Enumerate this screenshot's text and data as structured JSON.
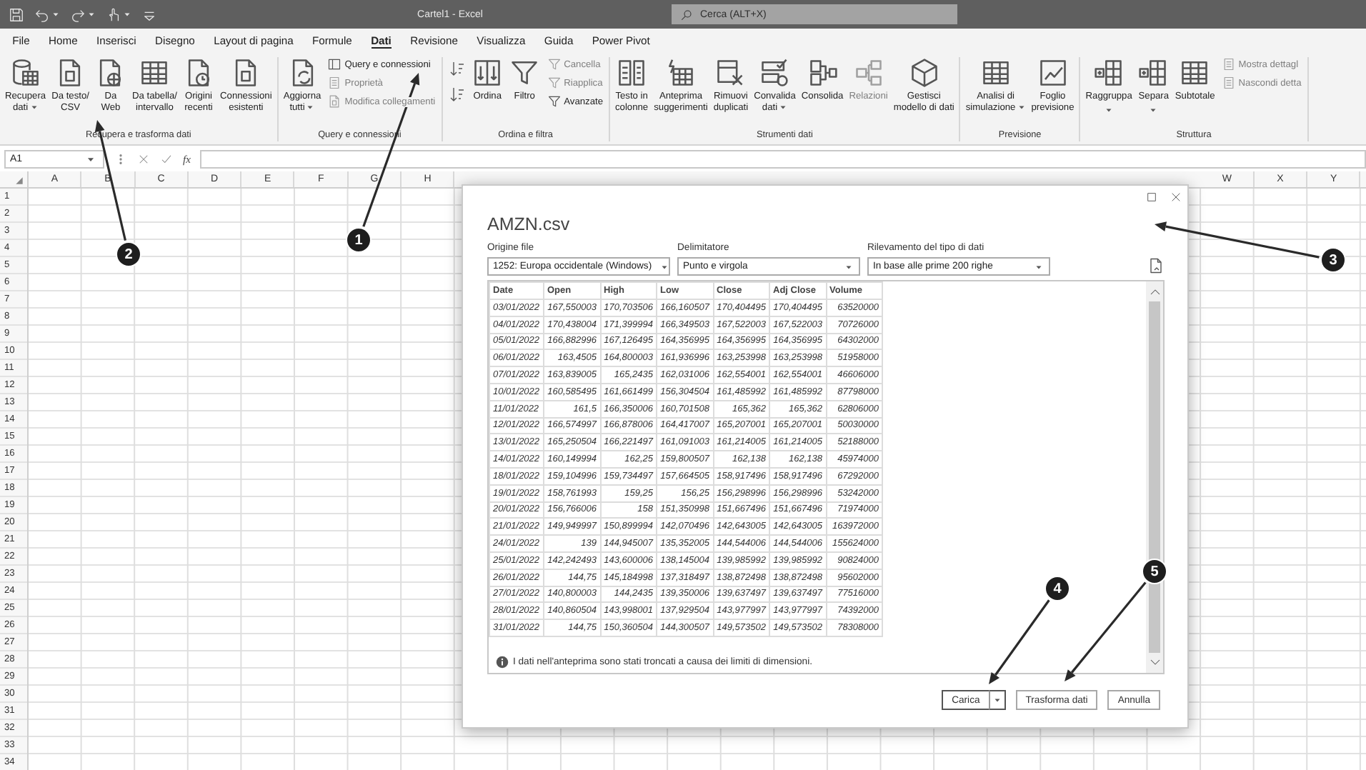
{
  "window": {
    "title": "Cartel1 - Excel"
  },
  "search": {
    "placeholder": "Cerca (ALT+X)"
  },
  "menu_tabs": [
    {
      "label": "File",
      "selected": false
    },
    {
      "label": "Home",
      "selected": false
    },
    {
      "label": "Inserisci",
      "selected": false
    },
    {
      "label": "Disegno",
      "selected": false
    },
    {
      "label": "Layout di pagina",
      "selected": false
    },
    {
      "label": "Formule",
      "selected": false
    },
    {
      "label": "Dati",
      "selected": true
    },
    {
      "label": "Revisione",
      "selected": false
    },
    {
      "label": "Visualizza",
      "selected": false
    },
    {
      "label": "Guida",
      "selected": false
    },
    {
      "label": "Power Pivot",
      "selected": false
    }
  ],
  "ribbon": {
    "groups": [
      {
        "label": "Recupera e trasforma dati",
        "buttons": [
          {
            "kind": "large",
            "label": "Recupera\ndati",
            "dropdown": true,
            "disabled": false
          },
          {
            "kind": "large",
            "label": "Da testo/\nCSV",
            "dropdown": false,
            "disabled": false
          },
          {
            "kind": "large",
            "label": "Da\nWeb",
            "dropdown": false,
            "disabled": false
          },
          {
            "kind": "large",
            "label": "Da tabella/\nintervallo",
            "dropdown": false,
            "disabled": false
          },
          {
            "kind": "large",
            "label": "Origini\nrecenti",
            "dropdown": false,
            "disabled": false
          },
          {
            "kind": "large",
            "label": "Connessioni\nesistenti",
            "dropdown": false,
            "disabled": false
          }
        ]
      },
      {
        "label": "Query e connessioni",
        "buttons": [
          {
            "kind": "large",
            "label": "Aggiorna\ntutti",
            "dropdown": true,
            "disabled": false
          },
          {
            "kind": "small",
            "label": "Query e connessioni",
            "dropdown": false,
            "disabled": false
          },
          {
            "kind": "small",
            "label": "Proprietà",
            "dropdown": false,
            "disabled": true
          },
          {
            "kind": "small",
            "label": "Modifica collegamenti",
            "dropdown": false,
            "disabled": true
          }
        ]
      },
      {
        "label": "Ordina e filtra",
        "buttons": [
          {
            "kind": "icon",
            "dropdown": false,
            "disabled": false
          },
          {
            "kind": "icon",
            "dropdown": false,
            "disabled": false
          },
          {
            "kind": "large",
            "label": "Ordina",
            "dropdown": false,
            "disabled": false
          },
          {
            "kind": "large",
            "label": "Filtro",
            "dropdown": false,
            "disabled": false
          },
          {
            "kind": "small",
            "label": "Cancella",
            "dropdown": false,
            "disabled": true
          },
          {
            "kind": "small",
            "label": "Riapplica",
            "dropdown": false,
            "disabled": true
          },
          {
            "kind": "small",
            "label": "Avanzate",
            "dropdown": false,
            "disabled": false
          }
        ]
      },
      {
        "label": "Strumenti dati",
        "buttons": [
          {
            "kind": "large",
            "label": "Testo in\ncolonne",
            "dropdown": false,
            "disabled": false
          },
          {
            "kind": "large",
            "label": "Anteprima\nsuggerimenti",
            "dropdown": false,
            "disabled": false
          },
          {
            "kind": "large",
            "label": "Rimuovi\nduplicati",
            "dropdown": false,
            "disabled": false
          },
          {
            "kind": "large",
            "label": "Convalida\ndati",
            "dropdown": true,
            "disabled": false
          },
          {
            "kind": "large",
            "label": "Consolida",
            "dropdown": false,
            "disabled": false
          },
          {
            "kind": "large",
            "label": "Relazioni",
            "dropdown": false,
            "disabled": true
          },
          {
            "kind": "large",
            "label": "Gestisci\nmodello di dati",
            "dropdown": false,
            "disabled": false
          }
        ]
      },
      {
        "label": "Previsione",
        "buttons": [
          {
            "kind": "large",
            "label": "Analisi di\nsimulazione",
            "dropdown": true,
            "disabled": false
          },
          {
            "kind": "large",
            "label": "Foglio\nprevisione",
            "dropdown": false,
            "disabled": false
          }
        ]
      },
      {
        "label": "Struttura",
        "buttons": [
          {
            "kind": "large",
            "label": "Raggruppa",
            "dropdown": true,
            "disabled": false
          },
          {
            "kind": "large",
            "label": "Separa",
            "dropdown": true,
            "disabled": false
          },
          {
            "kind": "large",
            "label": "Subtotale",
            "dropdown": false,
            "disabled": false
          },
          {
            "kind": "small",
            "label": "Mostra dettagl",
            "dropdown": false,
            "disabled": true
          },
          {
            "kind": "small",
            "label": "Nascondi detta",
            "dropdown": false,
            "disabled": true
          }
        ]
      }
    ]
  },
  "formula_bar": {
    "name_box": "A1",
    "function_label": "fx"
  },
  "sheet": {
    "columns_left": [
      "A",
      "B",
      "C",
      "D",
      "E",
      "F",
      "G",
      "H"
    ],
    "columns_right": [
      "W",
      "X",
      "Y"
    ],
    "rows": [
      "1",
      "2",
      "3",
      "4",
      "5",
      "6",
      "7",
      "8",
      "9",
      "10",
      "11",
      "12",
      "13",
      "14",
      "15",
      "16",
      "17",
      "18",
      "19",
      "20",
      "21",
      "22",
      "23",
      "24",
      "25",
      "26",
      "27",
      "28",
      "29",
      "30",
      "31",
      "32",
      "33",
      "34"
    ]
  },
  "dialog": {
    "title": "AMZN.csv",
    "fields": [
      {
        "label": "Origine file",
        "value": "1252: Europa occidentale (Windows)"
      },
      {
        "label": "Delimitatore",
        "value": "Punto e virgola"
      },
      {
        "label": "Rilevamento del tipo di dati",
        "value": "In base alle prime 200 righe"
      }
    ],
    "preview": {
      "columns": [
        "Date",
        "Open",
        "High",
        "Low",
        "Close",
        "Adj Close",
        "Volume"
      ],
      "rows": [
        [
          "03/01/2022",
          "167,550003",
          "170,703506",
          "166,160507",
          "170,404495",
          "170,404495",
          "63520000"
        ],
        [
          "04/01/2022",
          "170,438004",
          "171,399994",
          "166,349503",
          "167,522003",
          "167,522003",
          "70726000"
        ],
        [
          "05/01/2022",
          "166,882996",
          "167,126495",
          "164,356995",
          "164,356995",
          "164,356995",
          "64302000"
        ],
        [
          "06/01/2022",
          "163,4505",
          "164,800003",
          "161,936996",
          "163,253998",
          "163,253998",
          "51958000"
        ],
        [
          "07/01/2022",
          "163,839005",
          "165,2435",
          "162,031006",
          "162,554001",
          "162,554001",
          "46606000"
        ],
        [
          "10/01/2022",
          "160,585495",
          "161,661499",
          "156,304504",
          "161,485992",
          "161,485992",
          "87798000"
        ],
        [
          "11/01/2022",
          "161,5",
          "166,350006",
          "160,701508",
          "165,362",
          "165,362",
          "62806000"
        ],
        [
          "12/01/2022",
          "166,574997",
          "166,878006",
          "164,417007",
          "165,207001",
          "165,207001",
          "50030000"
        ],
        [
          "13/01/2022",
          "165,250504",
          "166,221497",
          "161,091003",
          "161,214005",
          "161,214005",
          "52188000"
        ],
        [
          "14/01/2022",
          "160,149994",
          "162,25",
          "159,800507",
          "162,138",
          "162,138",
          "45974000"
        ],
        [
          "18/01/2022",
          "159,104996",
          "159,734497",
          "157,664505",
          "158,917496",
          "158,917496",
          "67292000"
        ],
        [
          "19/01/2022",
          "158,761993",
          "159,25",
          "156,25",
          "156,298996",
          "156,298996",
          "53242000"
        ],
        [
          "20/01/2022",
          "156,766006",
          "158",
          "151,350998",
          "151,667496",
          "151,667496",
          "71974000"
        ],
        [
          "21/01/2022",
          "149,949997",
          "150,899994",
          "142,070496",
          "142,643005",
          "142,643005",
          "163972000"
        ],
        [
          "24/01/2022",
          "139",
          "144,945007",
          "135,352005",
          "144,544006",
          "144,544006",
          "155624000"
        ],
        [
          "25/01/2022",
          "142,242493",
          "143,600006",
          "138,145004",
          "139,985992",
          "139,985992",
          "90824000"
        ],
        [
          "26/01/2022",
          "144,75",
          "145,184998",
          "137,318497",
          "138,872498",
          "138,872498",
          "95602000"
        ],
        [
          "27/01/2022",
          "140,800003",
          "144,2435",
          "139,350006",
          "139,637497",
          "139,637497",
          "77516000"
        ],
        [
          "28/01/2022",
          "140,860504",
          "143,998001",
          "137,929504",
          "143,977997",
          "143,977997",
          "74392000"
        ],
        [
          "31/01/2022",
          "144,75",
          "150,360504",
          "144,300507",
          "149,573502",
          "149,573502",
          "78308000"
        ]
      ]
    },
    "info": "I dati nell'anteprima sono stati troncati a causa dei limiti di dimensioni.",
    "buttons": [
      {
        "kind": "split",
        "label": "Carica"
      },
      {
        "kind": "plain",
        "label": "Trasforma dati"
      },
      {
        "kind": "plain",
        "label": "Annulla"
      }
    ]
  },
  "callouts": [
    {
      "number": "1"
    },
    {
      "number": "2"
    },
    {
      "number": "3"
    },
    {
      "number": "4"
    },
    {
      "number": "5"
    }
  ]
}
